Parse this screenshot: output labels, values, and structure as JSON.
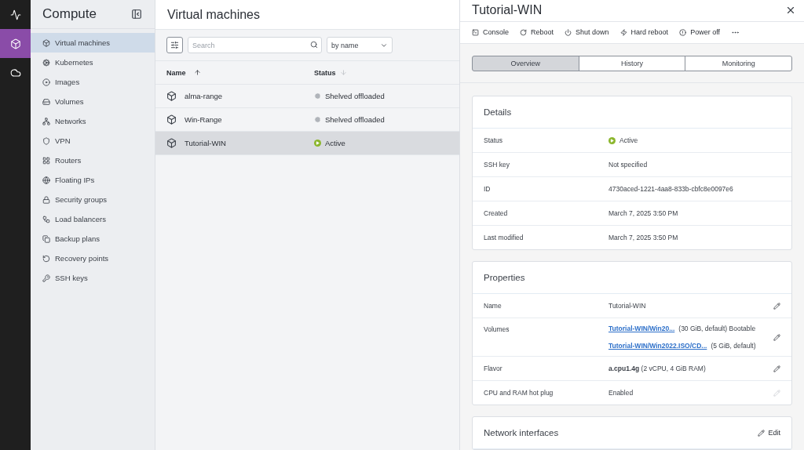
{
  "rail": [
    {
      "selected": false
    },
    {
      "selected": true
    },
    {
      "selected": false
    }
  ],
  "sidebar": {
    "title": "Compute",
    "items": [
      {
        "label": "Virtual machines",
        "selected": true
      },
      {
        "label": "Kubernetes",
        "selected": false
      },
      {
        "label": "Images",
        "selected": false
      },
      {
        "label": "Volumes",
        "selected": false
      },
      {
        "label": "Networks",
        "selected": false
      },
      {
        "label": "VPN",
        "selected": false
      },
      {
        "label": "Routers",
        "selected": false
      },
      {
        "label": "Floating IPs",
        "selected": false
      },
      {
        "label": "Security groups",
        "selected": false
      },
      {
        "label": "Load balancers",
        "selected": false
      },
      {
        "label": "Backup plans",
        "selected": false
      },
      {
        "label": "Recovery points",
        "selected": false
      },
      {
        "label": "SSH keys",
        "selected": false
      }
    ]
  },
  "list": {
    "title": "Virtual machines",
    "search": {
      "placeholder": "Search"
    },
    "sort": {
      "value": "by name"
    },
    "columns": [
      {
        "label": "Name",
        "sort_active": true,
        "sort_ascending": true
      },
      {
        "label": "Status",
        "sort_active": false,
        "sort_ascending": false
      }
    ],
    "rows": [
      {
        "name": "alma-range",
        "status": "Shelved offloaded",
        "active": false,
        "selected": false
      },
      {
        "name": "Win-Range",
        "status": "Shelved offloaded",
        "active": false,
        "selected": false
      },
      {
        "name": "Tutorial-WIN",
        "status": "Active",
        "active": true,
        "selected": true
      }
    ]
  },
  "detail": {
    "title": "Tutorial-WIN",
    "actions": [
      "Console",
      "Reboot",
      "Shut down",
      "Hard reboot",
      "Power off"
    ],
    "tabs": [
      {
        "label": "Overview",
        "selected": true
      },
      {
        "label": "History",
        "selected": false
      },
      {
        "label": "Monitoring",
        "selected": false
      }
    ],
    "details": {
      "title": "Details",
      "rows": [
        {
          "label": "Status",
          "value": "Active",
          "active": true
        },
        {
          "label": "SSH key",
          "value": "Not specified"
        },
        {
          "label": "ID",
          "value": "4730aced-1221-4aa8-833b-cbfc8e0097e6"
        },
        {
          "label": "Created",
          "value": "March 7, 2025 3:50 PM"
        },
        {
          "label": "Last modified",
          "value": "March 7, 2025 3:50 PM"
        }
      ]
    },
    "properties": {
      "title": "Properties",
      "rows": [
        {
          "kind": "text",
          "label": "Name",
          "value": "Tutorial-WIN",
          "editable": true
        },
        {
          "kind": "links",
          "label": "Volumes",
          "editable": true,
          "items": [
            {
              "link": "Tutorial-WIN/Win20...",
              "note": "(30 GiB, default) Bootable"
            },
            {
              "link": "Tutorial-WIN/Win2022.ISO/CD...",
              "note": "(5 GiB, default)"
            }
          ]
        },
        {
          "kind": "text",
          "label": "Flavor",
          "value": "**a.cpu1.4g** (2 vCPU, 4 GiB RAM)",
          "editable": true
        },
        {
          "kind": "text",
          "label": "CPU and RAM hot plug",
          "value": "Enabled",
          "editable": false
        }
      ]
    },
    "network": {
      "title": "Network interfaces",
      "edit": "Edit"
    }
  }
}
